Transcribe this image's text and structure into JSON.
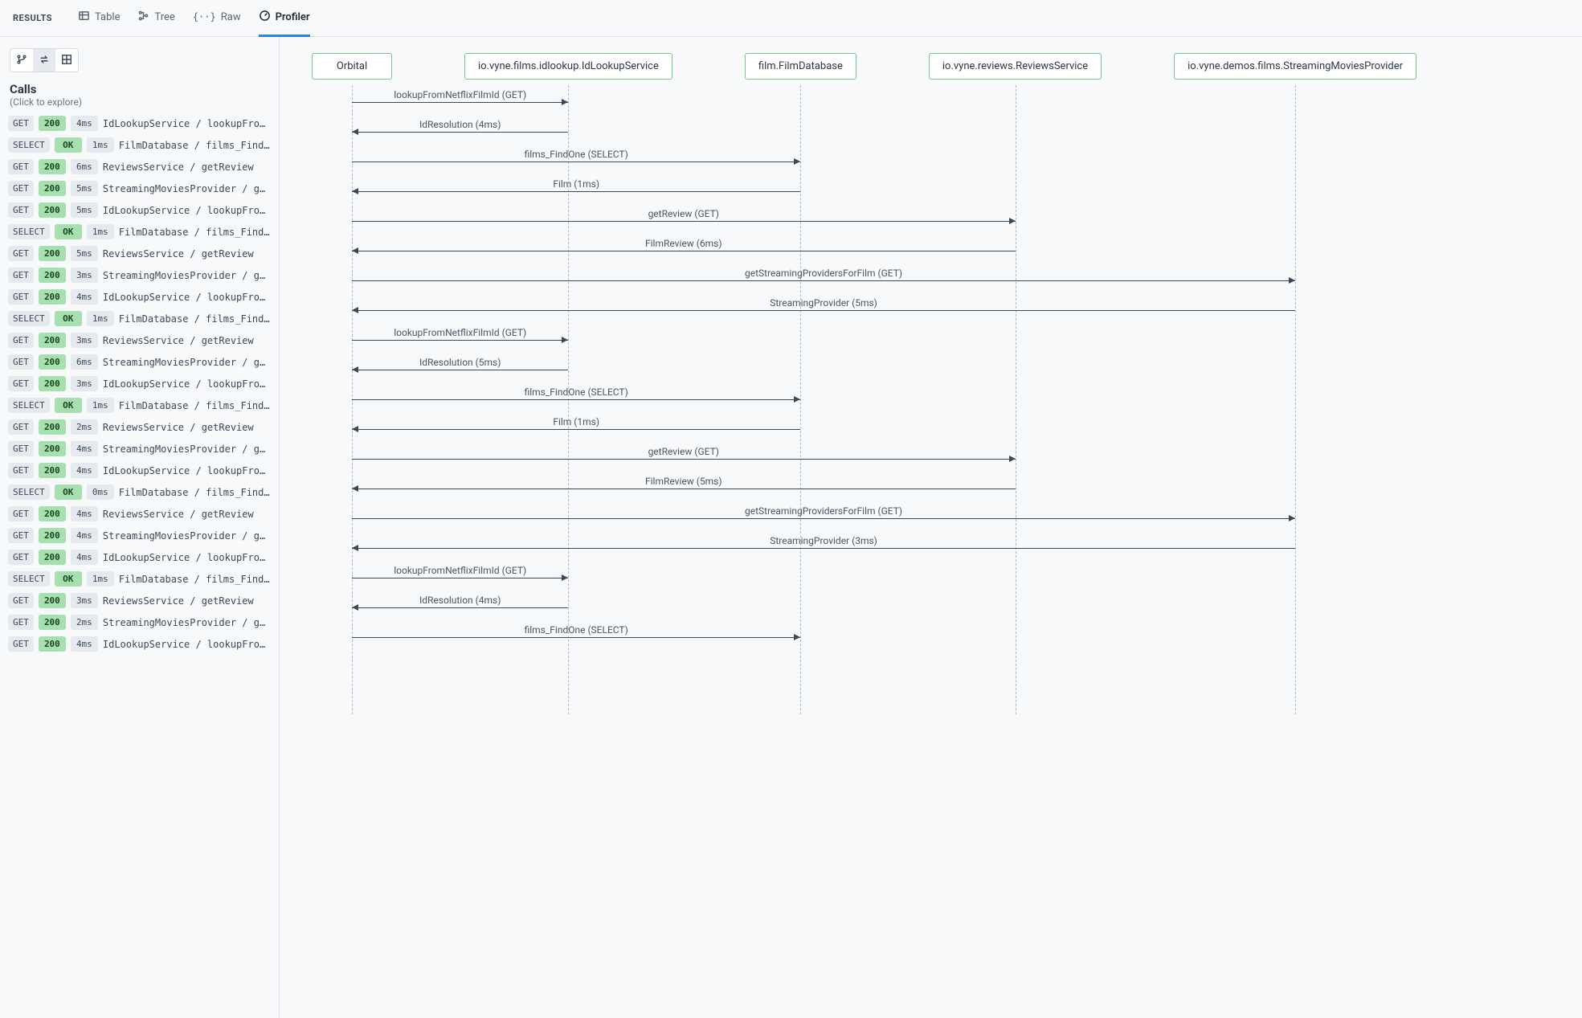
{
  "tabs": {
    "results_label": "RESULTS",
    "items": [
      {
        "label": "Table",
        "icon": "table"
      },
      {
        "label": "Tree",
        "icon": "tree"
      },
      {
        "label": "Raw",
        "icon": "raw"
      },
      {
        "label": "Profiler",
        "icon": "profiler"
      }
    ],
    "active": "Profiler"
  },
  "view_toggle": {
    "active_index": 1,
    "buttons": [
      {
        "name": "branch-view",
        "icon": "branch"
      },
      {
        "name": "swap-view",
        "icon": "swap"
      },
      {
        "name": "grid-view",
        "icon": "grid"
      }
    ]
  },
  "calls": {
    "title": "Calls",
    "subtitle": "(Click to explore)",
    "items": [
      {
        "method": "GET",
        "status": "200",
        "time": "4ms",
        "label": "IdLookupService / lookupFromNetflix…"
      },
      {
        "method": "SELECT",
        "status": "OK",
        "time": "1ms",
        "label": "FilmDatabase / films_FindOne"
      },
      {
        "method": "GET",
        "status": "200",
        "time": "6ms",
        "label": "ReviewsService / getReview"
      },
      {
        "method": "GET",
        "status": "200",
        "time": "5ms",
        "label": "StreamingMoviesProvider / getStream…"
      },
      {
        "method": "GET",
        "status": "200",
        "time": "5ms",
        "label": "IdLookupService / lookupFromNetflix…"
      },
      {
        "method": "SELECT",
        "status": "OK",
        "time": "1ms",
        "label": "FilmDatabase / films_FindOne"
      },
      {
        "method": "GET",
        "status": "200",
        "time": "5ms",
        "label": "ReviewsService / getReview"
      },
      {
        "method": "GET",
        "status": "200",
        "time": "3ms",
        "label": "StreamingMoviesProvider / getStream…"
      },
      {
        "method": "GET",
        "status": "200",
        "time": "4ms",
        "label": "IdLookupService / lookupFromNetflix…"
      },
      {
        "method": "SELECT",
        "status": "OK",
        "time": "1ms",
        "label": "FilmDatabase / films_FindOne"
      },
      {
        "method": "GET",
        "status": "200",
        "time": "3ms",
        "label": "ReviewsService / getReview"
      },
      {
        "method": "GET",
        "status": "200",
        "time": "6ms",
        "label": "StreamingMoviesProvider / getStream…"
      },
      {
        "method": "GET",
        "status": "200",
        "time": "3ms",
        "label": "IdLookupService / lookupFromNetflix…"
      },
      {
        "method": "SELECT",
        "status": "OK",
        "time": "1ms",
        "label": "FilmDatabase / films_FindOne"
      },
      {
        "method": "GET",
        "status": "200",
        "time": "2ms",
        "label": "ReviewsService / getReview"
      },
      {
        "method": "GET",
        "status": "200",
        "time": "4ms",
        "label": "StreamingMoviesProvider / getStream…"
      },
      {
        "method": "GET",
        "status": "200",
        "time": "4ms",
        "label": "IdLookupService / lookupFromNetflix…"
      },
      {
        "method": "SELECT",
        "status": "OK",
        "time": "0ms",
        "label": "FilmDatabase / films_FindOne"
      },
      {
        "method": "GET",
        "status": "200",
        "time": "4ms",
        "label": "ReviewsService / getReview"
      },
      {
        "method": "GET",
        "status": "200",
        "time": "4ms",
        "label": "StreamingMoviesProvider / getStream…"
      },
      {
        "method": "GET",
        "status": "200",
        "time": "4ms",
        "label": "IdLookupService / lookupFromNetflix…"
      },
      {
        "method": "SELECT",
        "status": "OK",
        "time": "1ms",
        "label": "FilmDatabase / films_FindOne"
      },
      {
        "method": "GET",
        "status": "200",
        "time": "3ms",
        "label": "ReviewsService / getReview"
      },
      {
        "method": "GET",
        "status": "200",
        "time": "2ms",
        "label": "StreamingMoviesProvider / getStream…"
      },
      {
        "method": "GET",
        "status": "200",
        "time": "4ms",
        "label": "IdLookupService / lookupFromNetflix…"
      }
    ]
  },
  "sequence": {
    "lanes": [
      {
        "id": "orbital",
        "label": "Orbital"
      },
      {
        "id": "idlookup",
        "label": "io.vyne.films.idlookup.IdLookupService"
      },
      {
        "id": "filmdb",
        "label": "film.FilmDatabase"
      },
      {
        "id": "reviews",
        "label": "io.vyne.reviews.ReviewsService"
      },
      {
        "id": "stream",
        "label": "io.vyne.demos.films.StreamingMoviesProvider"
      }
    ],
    "lane_x": {
      "orbital": 50,
      "idlookup": 250,
      "filmdb": 434,
      "reviews": 596,
      "stream": 822
    },
    "messages": [
      {
        "from": "orbital",
        "to": "idlookup",
        "text": "lookupFromNetflixFilmId (GET)"
      },
      {
        "from": "idlookup",
        "to": "orbital",
        "text": "IdResolution (4ms)"
      },
      {
        "from": "orbital",
        "to": "filmdb",
        "text": "films_FindOne (SELECT)"
      },
      {
        "from": "filmdb",
        "to": "orbital",
        "text": "Film (1ms)"
      },
      {
        "from": "orbital",
        "to": "reviews",
        "text": "getReview (GET)"
      },
      {
        "from": "reviews",
        "to": "orbital",
        "text": "FilmReview (6ms)"
      },
      {
        "from": "orbital",
        "to": "stream",
        "text": "getStreamingProvidersForFilm (GET)"
      },
      {
        "from": "stream",
        "to": "orbital",
        "text": "StreamingProvider (5ms)"
      },
      {
        "from": "orbital",
        "to": "idlookup",
        "text": "lookupFromNetflixFilmId (GET)"
      },
      {
        "from": "idlookup",
        "to": "orbital",
        "text": "IdResolution (5ms)"
      },
      {
        "from": "orbital",
        "to": "filmdb",
        "text": "films_FindOne (SELECT)"
      },
      {
        "from": "filmdb",
        "to": "orbital",
        "text": "Film (1ms)"
      },
      {
        "from": "orbital",
        "to": "reviews",
        "text": "getReview (GET)"
      },
      {
        "from": "reviews",
        "to": "orbital",
        "text": "FilmReview (5ms)"
      },
      {
        "from": "orbital",
        "to": "stream",
        "text": "getStreamingProvidersForFilm (GET)"
      },
      {
        "from": "stream",
        "to": "orbital",
        "text": "StreamingProvider (3ms)"
      },
      {
        "from": "orbital",
        "to": "idlookup",
        "text": "lookupFromNetflixFilmId (GET)"
      },
      {
        "from": "idlookup",
        "to": "orbital",
        "text": "IdResolution (4ms)"
      },
      {
        "from": "orbital",
        "to": "filmdb",
        "text": "films_FindOne (SELECT)"
      }
    ]
  }
}
